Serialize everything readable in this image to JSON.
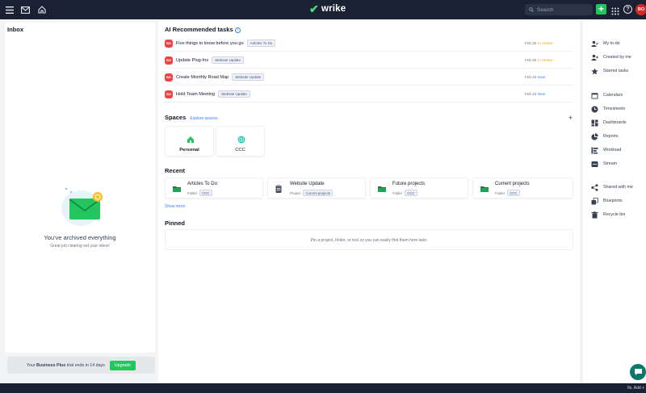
{
  "topbar": {
    "logo": "wrike",
    "search_placeholder": "Search",
    "avatar_initials": "BO",
    "colors": {
      "bar": "#1a2133",
      "accent": "#22c55e",
      "avatar": "#dc2626"
    }
  },
  "inbox": {
    "title": "Inbox",
    "empty_title": "You've archived everything",
    "empty_subtitle": "Great job clearing out your inbox!",
    "trial_prefix": "Your ",
    "trial_plan": "Business Plus",
    "trial_suffix": " trial ends in 14 days",
    "upgrade_label": "Upgrade"
  },
  "ai_tasks": {
    "title": "AI Recommended tasks",
    "items": [
      {
        "badge": "BO",
        "name": "Five things to know before you go",
        "tag": "Articles To Do",
        "date": "Feb 20",
        "status": "In review",
        "status_color": "#f59e0b"
      },
      {
        "badge": "BO",
        "name": "Update Plug-Ins",
        "tag": "Website Update",
        "date": "Feb 20",
        "status": "In review",
        "status_color": "#f59e0b"
      },
      {
        "badge": "BO",
        "name": "Create Monthly Road Map",
        "tag": "Website Update",
        "date": "Feb 23",
        "status": "New",
        "status_color": "#3b82f6"
      },
      {
        "badge": "BO",
        "name": "Hold Team Meeting",
        "tag": "Website Update",
        "date": "Feb 23",
        "status": "New",
        "status_color": "#3b82f6"
      }
    ]
  },
  "spaces": {
    "title": "Spaces",
    "explore_label": "Explore spaces",
    "add_label": "+",
    "items": [
      {
        "name": "Personal",
        "icon": "home-icon"
      },
      {
        "name": "CCC",
        "icon": "globe-icon"
      }
    ]
  },
  "recent": {
    "title": "Recent",
    "show_more": "Show more",
    "items": [
      {
        "name": "Articles To Do",
        "kind": "Folder",
        "space": "CCC",
        "icon": "folder-icon"
      },
      {
        "name": "Website Update",
        "kind": "Project",
        "space": "Current projects",
        "icon": "project-icon"
      },
      {
        "name": "Future projects",
        "kind": "Folder",
        "space": "CCC",
        "icon": "folder-icon"
      },
      {
        "name": "Current projects",
        "kind": "Folder",
        "space": "CCC",
        "icon": "folder-icon"
      }
    ]
  },
  "pinned": {
    "title": "Pinned",
    "empty_text": "Pin a project, folder, or tool so you can easily find them here later."
  },
  "sidebar": {
    "items": [
      {
        "label": "My to-do",
        "icon": "user-check-icon"
      },
      {
        "label": "Created by me",
        "icon": "user-plus-icon"
      },
      {
        "label": "Starred tasks",
        "icon": "star-icon"
      },
      {
        "label": "Calendars",
        "icon": "calendar-icon"
      },
      {
        "label": "Timesheets",
        "icon": "clock-icon"
      },
      {
        "label": "Dashboards",
        "icon": "dashboard-icon"
      },
      {
        "label": "Reports",
        "icon": "pie-chart-icon"
      },
      {
        "label": "Workload",
        "icon": "workload-icon"
      },
      {
        "label": "Stream",
        "icon": "stream-icon"
      },
      {
        "label": "Shared with me",
        "icon": "share-icon"
      },
      {
        "label": "Blueprints",
        "icon": "blueprint-icon"
      },
      {
        "label": "Recycle bin",
        "icon": "trash-icon"
      }
    ]
  },
  "footer": {
    "corner_text": "Ifs. Add +"
  }
}
